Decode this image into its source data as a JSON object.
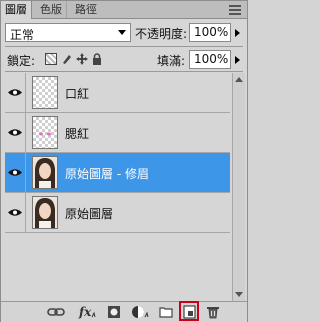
{
  "tabs": [
    "圖層",
    "色版",
    "路徑"
  ],
  "blend_mode": "正常",
  "opacity_label": "不透明度:",
  "opacity_value": "100%",
  "lock_label": "鎖定:",
  "fill_label": "填滿:",
  "fill_value": "100%",
  "layers": [
    {
      "name": "口紅",
      "visible": true,
      "selected": false,
      "thumbnail": "transparent-mask"
    },
    {
      "name": "腮紅",
      "visible": true,
      "selected": false,
      "thumbnail": "transparent-blush"
    },
    {
      "name": "原始圖層 - 修眉",
      "visible": true,
      "selected": true,
      "thumbnail": "photo"
    },
    {
      "name": "原始圖層",
      "visible": true,
      "selected": false,
      "thumbnail": "photo"
    }
  ],
  "bottom_icons": [
    "link-icon",
    "fx-icon",
    "mask-icon",
    "adjustment-icon",
    "folder-icon",
    "new-layer-icon",
    "trash-icon"
  ],
  "colors": {
    "selected": "#3d96e8",
    "highlight": "#c8001c"
  }
}
